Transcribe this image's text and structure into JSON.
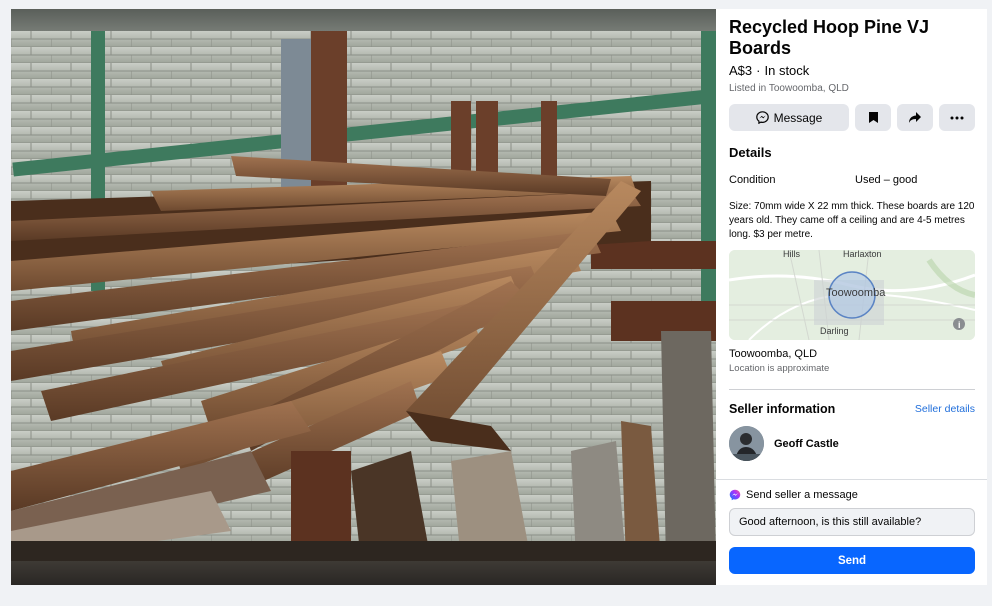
{
  "listing": {
    "title": "Recycled Hoop Pine VJ Boards",
    "price": "A$3",
    "separator": "·",
    "stock": "In stock",
    "listed": "Listed in Toowoomba, QLD"
  },
  "actions": {
    "message_label": "Message",
    "icons": [
      "messenger-icon",
      "bookmark-icon",
      "share-icon",
      "more-icon"
    ]
  },
  "details": {
    "heading": "Details",
    "condition_label": "Condition",
    "condition_value": "Used – good",
    "description": "Size: 70mm wide X 22 mm thick. These boards are 120 years old. They came off a ceiling and are 4-5 metres long. $3 per metre."
  },
  "map": {
    "city": "Toowoomba",
    "labels": [
      "Hills",
      "Harlaxton",
      "Darling"
    ],
    "location": "Toowoomba, QLD",
    "approx_note": "Location is approximate"
  },
  "seller": {
    "heading": "Seller information",
    "details_link": "Seller details",
    "name": "Geoff Castle"
  },
  "composer": {
    "heading": "Send seller a message",
    "input_value": "Good afternoon, is this still available?",
    "send_label": "Send"
  },
  "colors": {
    "accent": "#0866ff",
    "link": "#216fdb",
    "button_bg": "#e4e6eb"
  }
}
